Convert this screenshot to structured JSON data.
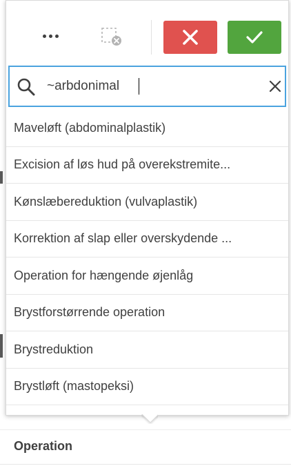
{
  "toolbar": {
    "more_icon": "more-options-icon",
    "clear_selection_icon": "clear-selections-icon",
    "cancel_icon": "close-icon",
    "confirm_icon": "check-icon",
    "colors": {
      "cancel": "#e0524f",
      "confirm": "#52a53e"
    }
  },
  "search": {
    "value": "~arbdonimal",
    "icon": "search-icon",
    "clear_icon": "close-icon",
    "border_color": "#4aa3df"
  },
  "list": {
    "items": [
      {
        "label": "Maveløft (abdominalplastik)"
      },
      {
        "label": "Excision af løs hud på overekstremite..."
      },
      {
        "label": "Kønslæbereduktion (vulvaplastik)"
      },
      {
        "label": "Korrektion af slap eller overskydende ..."
      },
      {
        "label": "Operation for hængende øjenlåg"
      },
      {
        "label": "Brystforstørrende operation"
      },
      {
        "label": "Brystreduktion"
      },
      {
        "label": "Brystløft (mastopeksi)"
      }
    ]
  },
  "field": {
    "title": "Operation"
  }
}
